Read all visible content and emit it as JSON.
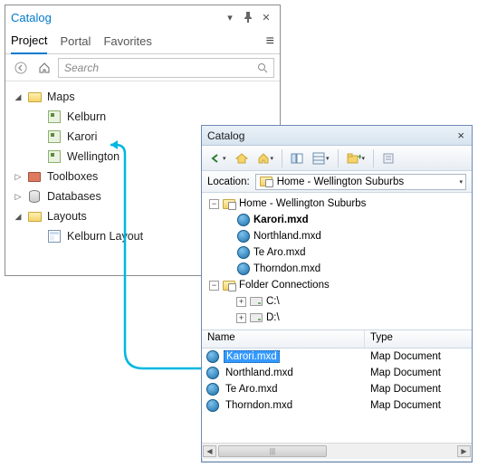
{
  "pane1": {
    "title": "Catalog",
    "tabs": {
      "project": "Project",
      "portal": "Portal",
      "favorites": "Favorites"
    },
    "search_placeholder": "Search",
    "tree": {
      "maps": {
        "label": "Maps",
        "items": [
          "Kelburn",
          "Karori",
          "Wellington"
        ]
      },
      "toolboxes": "Toolboxes",
      "databases": "Databases",
      "layouts": {
        "label": "Layouts",
        "items": [
          "Kelburn Layout"
        ]
      }
    }
  },
  "pane2": {
    "title": "Catalog",
    "location_label": "Location:",
    "location_value": "Home - Wellington Suburbs",
    "tree": {
      "home": "Home - Wellington Suburbs",
      "home_items": [
        "Karori.mxd",
        "Northland.mxd",
        "Te Aro.mxd",
        "Thorndon.mxd"
      ],
      "folder_connections": "Folder Connections",
      "drives": [
        "C:\\",
        "D:\\"
      ]
    },
    "list": {
      "col_name": "Name",
      "col_type": "Type",
      "rows": [
        {
          "name": "Karori.mxd",
          "type": "Map Document",
          "selected": true
        },
        {
          "name": "Northland.mxd",
          "type": "Map Document",
          "selected": false
        },
        {
          "name": "Te Aro.mxd",
          "type": "Map Document",
          "selected": false
        },
        {
          "name": "Thorndon.mxd",
          "type": "Map Document",
          "selected": false
        }
      ]
    },
    "scrollbar_grip": "|||"
  }
}
